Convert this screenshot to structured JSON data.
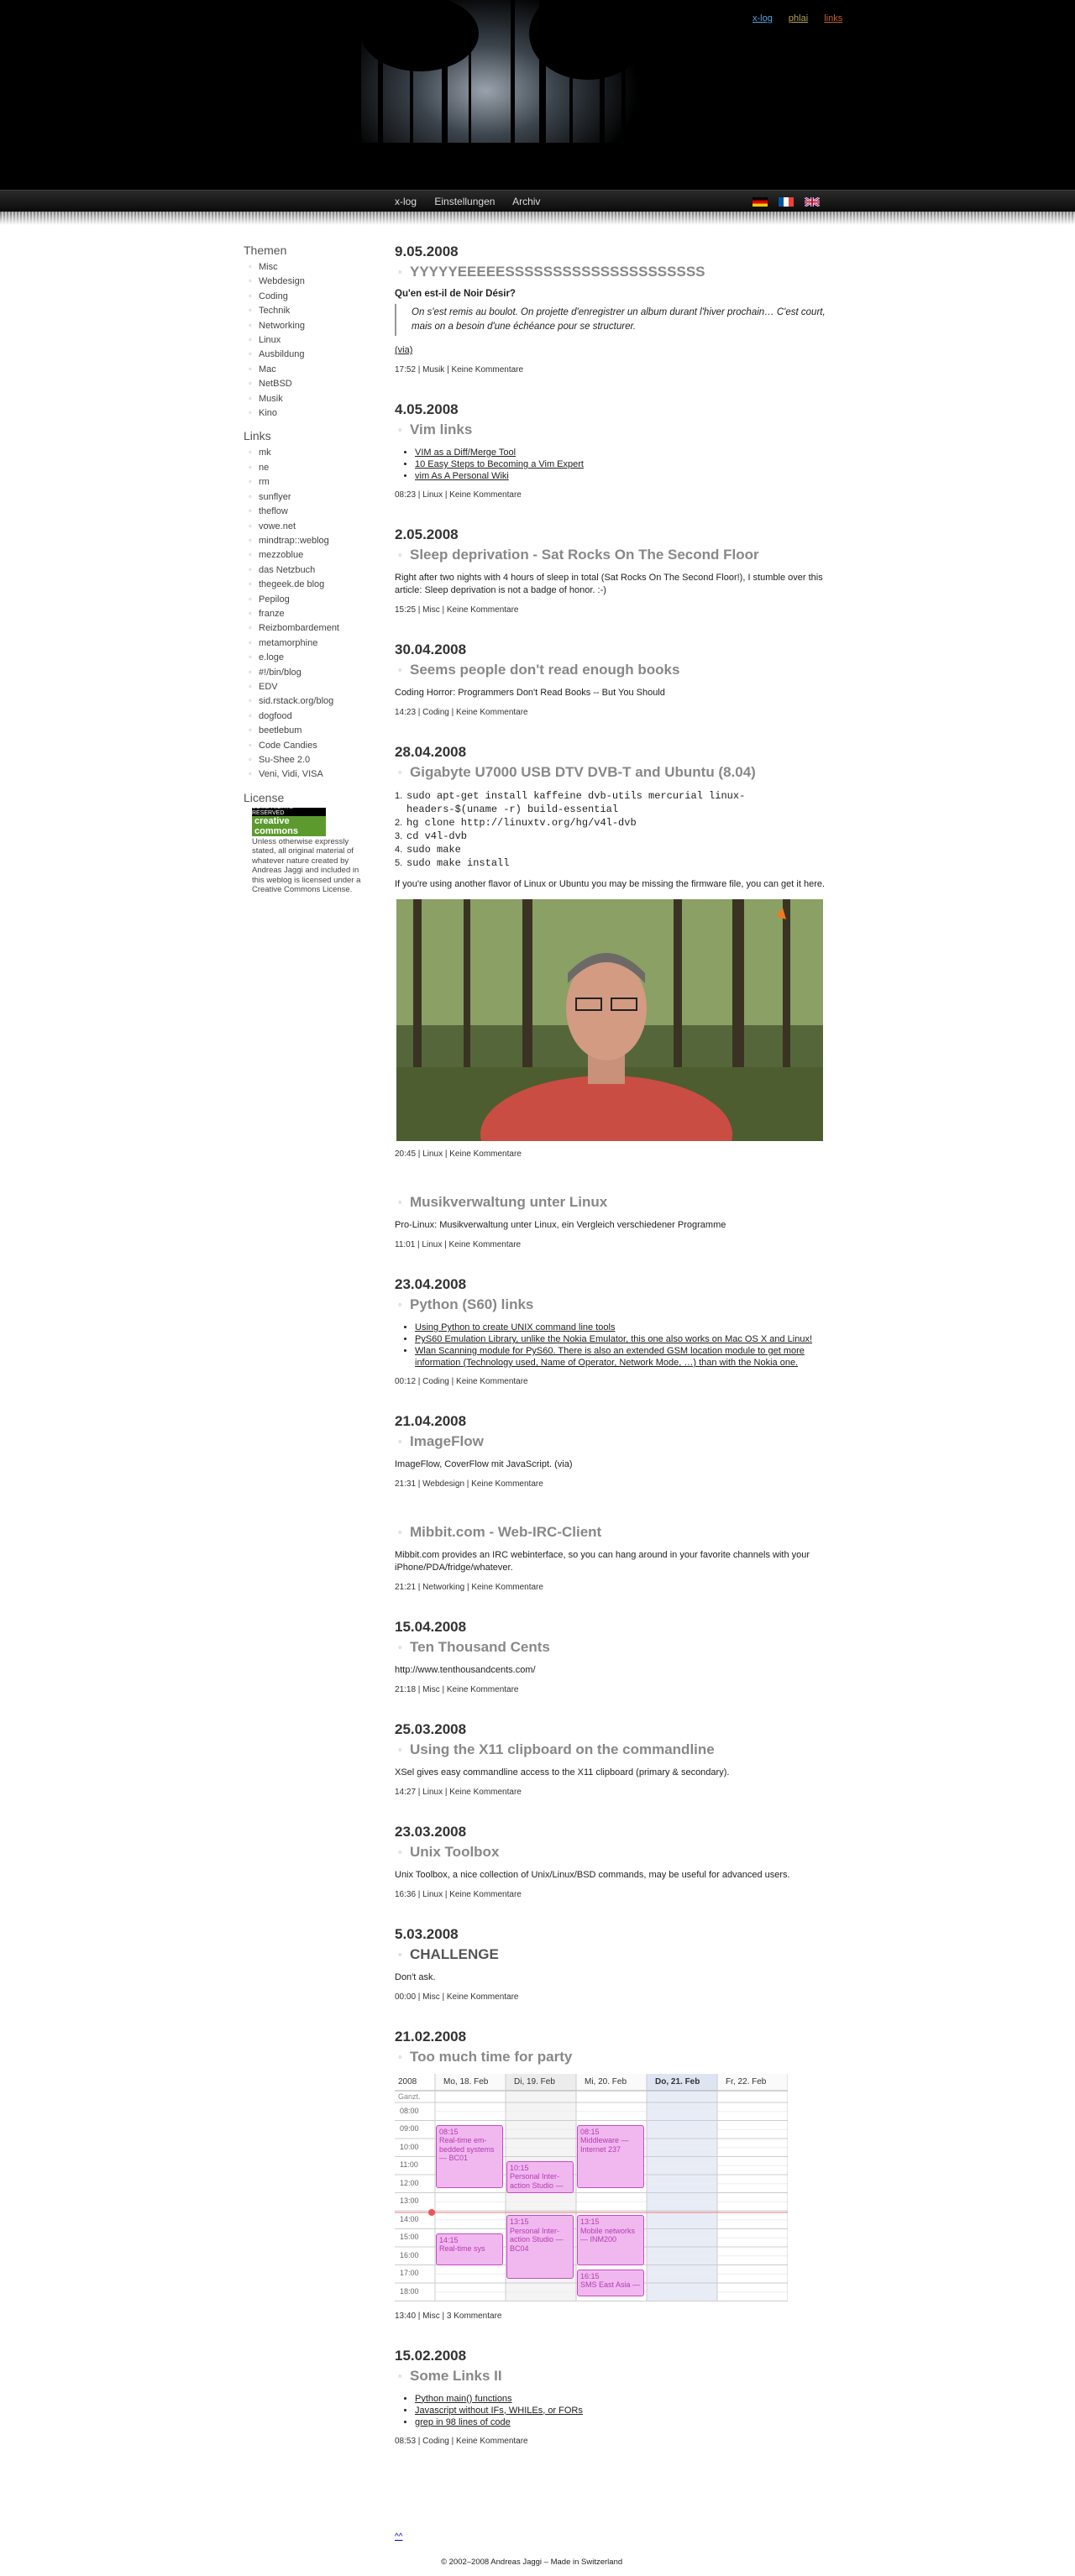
{
  "header": {
    "top_links": [
      "x-log",
      "phlai",
      "links"
    ]
  },
  "nav": {
    "items": [
      "x-log",
      "Einstellungen",
      "Archiv"
    ]
  },
  "sidebar": {
    "themen_title": "Themen",
    "themen": [
      "Misc",
      "Webdesign",
      "Coding",
      "Technik",
      "Networking",
      "Linux",
      "Ausbildung",
      "Mac",
      "NetBSD",
      "Musik",
      "Kino"
    ],
    "links_title": "Links",
    "links": [
      "mk",
      "ne",
      "rm",
      "sunflyer",
      "theflow",
      "vowe.net",
      "mindtrap::weblog",
      "mezzoblue",
      "das Netzbuch",
      "thegeek.de blog",
      "Pepilog",
      "franze",
      "Reizbombardement",
      "metamorphine",
      "e.loge",
      "#!/bin/blog",
      "EDV",
      "sid.rstack.org/blog",
      "dogfood",
      "beetlebum",
      "Code Candies",
      "Su-Shee 2.0",
      "Veni, Vidi, VISA"
    ],
    "license_title": "License",
    "license_badge_top": "SOME RIGHTS RESERVED",
    "license_badge_main": "creative commons",
    "license_text": "Unless otherwise expressly stated, all original material of whatever nature created by Andreas Jaggi and included in this weblog is licensed under a Creative Commons License."
  },
  "posts": [
    {
      "date": "9.05.2008",
      "title": "YYYYYEEEEESSSSSSSSSSSSSSSSSSSSS",
      "subhead": "Qu'en est-il de Noir Désir?",
      "quote": "On s'est remis au boulot. On projette d'enregistrer un album durant l'hiver prochain… C'est court, mais on a besoin d'une échéance pour se structurer.",
      "via": "(via)",
      "meta": "17:52 | Musik | Keine Kommentare"
    },
    {
      "date": "4.05.2008",
      "title": "Vim links",
      "items": [
        "VIM as a Diff/Merge Tool",
        "10 Easy Steps to Becoming a Vim Expert",
        "vim As A Personal Wiki"
      ],
      "meta": "08:23 | Linux | Keine Kommentare"
    },
    {
      "date": "2.05.2008",
      "title": "Sleep deprivation - Sat Rocks On The Second Floor",
      "body": "Right after two nights with 4 hours of sleep in total (Sat Rocks On The Second Floor!), I stumble over this article: Sleep deprivation is not a badge of honor. :-)",
      "meta": "15:25 | Misc | Keine Kommentare"
    },
    {
      "date": "30.04.2008",
      "title": "Seems people don't read enough books",
      "body": "Coding Horror: Programmers Don't Read Books -- But You Should",
      "meta": "14:23 | Coding | Keine Kommentare"
    },
    {
      "date": "28.04.2008",
      "title": "Gigabyte U7000 USB DTV DVB-T and Ubuntu (8.04)",
      "code": [
        "sudo apt-get install kaffeine dvb-utils mercurial linux-",
        "headers-$(uname -r) build-essential",
        "hg clone http://linuxtv.org/hg/v4l-dvb",
        "cd v4l-dvb",
        "sudo make",
        "sudo make install"
      ],
      "code_numbers": [
        "1.",
        "",
        "2.",
        "3.",
        "4.",
        "5."
      ],
      "body": "If you're using another flavor of Linux or Ubuntu you may be missing the firmware file, you can get it here.",
      "meta": "20:45 | Linux | Keine Kommentare"
    },
    {
      "date": "",
      "title": "Musikverwaltung unter Linux",
      "body": "Pro-Linux: Musikverwaltung unter Linux, ein Vergleich verschiedener Programme",
      "meta": "11:01 | Linux | Keine Kommentare"
    },
    {
      "date": "23.04.2008",
      "title": "Python (S60) links",
      "items": [
        "Using Python to create UNIX command line tools",
        "PyS60 Emulation Library, unlike the Nokia Emulator, this one also works on Mac OS X and Linux!",
        "Wlan Scanning module for PyS60. There is also an extended GSM location module to get more information (Technology used, Name of Operator, Network Mode, …) than with the Nokia one."
      ],
      "meta": "00:12 | Coding | Keine Kommentare"
    },
    {
      "date": "21.04.2008",
      "title": "ImageFlow",
      "body": "ImageFlow, CoverFlow mit JavaScript. (via)",
      "meta": "21:31 | Webdesign | Keine Kommentare"
    },
    {
      "date": "",
      "title": "Mibbit.com - Web-IRC-Client",
      "body": "Mibbit.com provides an IRC webinterface, so you can hang around in your favorite channels with your iPhone/PDA/fridge/whatever.",
      "meta": "21:21 | Networking | Keine Kommentare"
    },
    {
      "date": "15.04.2008",
      "title": "Ten Thousand Cents",
      "body": "http://www.tenthousandcents.com/",
      "meta": "21:18 | Misc | Keine Kommentare"
    },
    {
      "date": "25.03.2008",
      "title": "Using the X11 clipboard on the commandline",
      "body": "XSel gives easy commandline access to the X11 clipboard (primary & secondary).",
      "meta": "14:27 | Linux | Keine Kommentare"
    },
    {
      "date": "23.03.2008",
      "title": "Unix Toolbox",
      "body": "Unix Toolbox, a nice collection of Unix/Linux/BSD commands, may be useful for advanced users.",
      "meta": "16:36 | Linux | Keine Kommentare"
    },
    {
      "date": "5.03.2008",
      "title": "CHALLENGE",
      "body": "Don't ask.",
      "meta": "00:00 | Misc | Keine Kommentare"
    },
    {
      "date": "21.02.2008",
      "title": "Too much time for party",
      "calendar": {
        "year": "2008",
        "days": [
          "Mo, 18. Feb",
          "Di, 19. Feb",
          "Mi, 20. Feb",
          "Do, 21. Feb",
          "Fr, 22. Feb"
        ],
        "allday": "Ganzt.",
        "hours": [
          "08:00",
          "09:00",
          "10:00",
          "11:00",
          "12:00",
          "13:00",
          "14:00",
          "15:00",
          "16:00",
          "17:00",
          "18:00"
        ],
        "events": [
          {
            "day": 0,
            "start": 9.25,
            "end": 12.75,
            "text": "08:15\nReal-time em-\nbedded systems\n— BC01"
          },
          {
            "day": 1,
            "start": 11.25,
            "end": 13.0,
            "text": "10:15\nPersonal Inter-\naction Studio —"
          },
          {
            "day": 2,
            "start": 9.25,
            "end": 12.75,
            "text": "08:15\nMiddleware —\nInternet 237"
          },
          {
            "day": 0,
            "start": 15.25,
            "end": 17.0,
            "text": "14:15\nReal-time sys"
          },
          {
            "day": 1,
            "start": 14.25,
            "end": 17.75,
            "text": "13:15\nPersonal Inter-\naction Studio —\nBC04"
          },
          {
            "day": 2,
            "start": 14.25,
            "end": 17.0,
            "text": "13:15\nMobile networks\n— INM200"
          },
          {
            "day": 2,
            "start": 17.25,
            "end": 18.75,
            "text": "16:15\nSMS East Asia —"
          }
        ]
      },
      "meta": "13:40 | Misc | 3 Kommentare"
    },
    {
      "date": "15.02.2008",
      "title": "Some Links II",
      "items": [
        "Python main() functions",
        "Javascript without IFs, WHILEs, or FORs",
        "grep in 98 lines of code"
      ],
      "meta": "08:53 | Coding | Keine Kommentare"
    }
  ],
  "footer": {
    "up_link": "^^",
    "copyright": "© 2002–2008 Andreas Jaggi – Made in Switzerland"
  },
  "colors": {
    "event_fill": "#f0b8ef",
    "event_border": "#c948c6",
    "event_text": "#b63bb3",
    "today_bg": "#e8ecf6"
  }
}
